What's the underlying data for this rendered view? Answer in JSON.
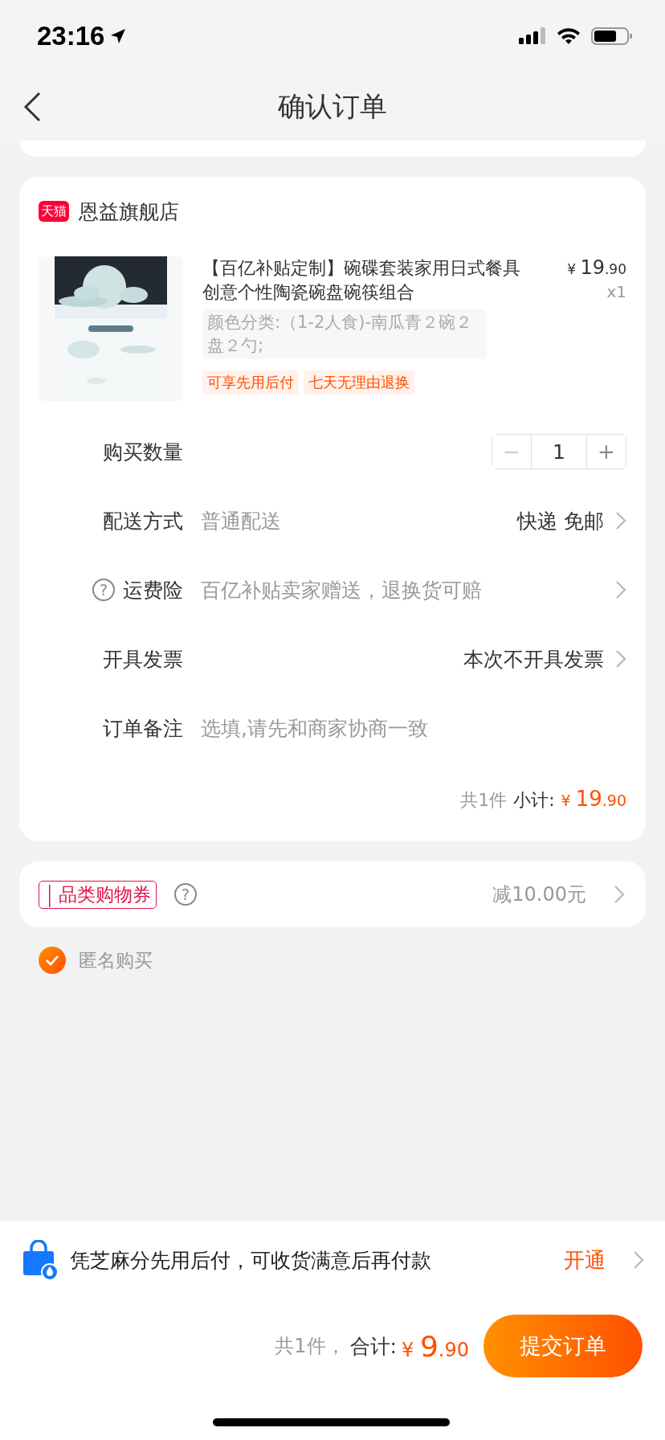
{
  "status_bar": {
    "time": "23:16"
  },
  "nav": {
    "title": "确认订单"
  },
  "shop": {
    "badge": "天猫",
    "name": "恩益旗舰店",
    "product": {
      "kind": "picture",
      "title": "【百亿补贴定制】碗碟套装家用日式餐具创意个性陶瓷碗盘碗筷组合",
      "price": {
        "symbol": "¥",
        "integer": "19",
        "decimal": ".90"
      },
      "count": "x1",
      "spec": "颜色分类:（1-2人食)-南瓜青２碗２盘２勺;",
      "tags": [
        "可享先用后付",
        "七天无理由退换"
      ]
    },
    "rows": [
      {
        "kind": "stepper",
        "label": "购买数量",
        "minus": "−",
        "value": "1",
        "plus": "+",
        "minus_disabled": true
      },
      {
        "kind": "link",
        "label": "配送方式",
        "hint": "普通配送",
        "value": "快递 免邮"
      },
      {
        "kind": "help",
        "label": "运费险",
        "help": "?",
        "hint": "百亿补贴卖家赠送，退换货可赔"
      },
      {
        "kind": "link",
        "label": "开具发票",
        "value": "本次不开具发票"
      },
      {
        "kind": "input",
        "label": "订单备注",
        "placeholder": "选填,请先和商家协商一致"
      }
    ],
    "summary": {
      "count": "共1件",
      "label": "小计:",
      "price": {
        "symbol": "¥",
        "integer": "19",
        "decimal": ".90"
      }
    }
  },
  "coupon": {
    "tag": "品类购物券",
    "help": "?",
    "value": "减10.00元"
  },
  "anonymous": {
    "label": "匿名购买",
    "checked": true
  },
  "pay_later": {
    "text": "凭芝麻分先用后付，可收货满意后再付款",
    "action": "开通"
  },
  "footer": {
    "count": "共1件，",
    "label": "合计:",
    "price": {
      "symbol": "¥",
      "integer": "9",
      "decimal": ".90"
    },
    "submit": "提交订单"
  }
}
